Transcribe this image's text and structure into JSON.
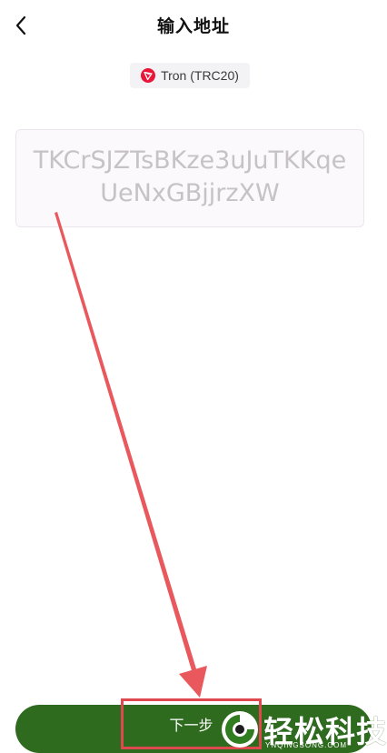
{
  "header": {
    "title": "输入地址",
    "back_icon": "chevron-left-icon"
  },
  "network": {
    "label": "Tron (TRC20)",
    "icon": "tron-icon",
    "icon_color": "#e8173a"
  },
  "address": {
    "placeholder": "TKCrSJZTsBKze3uJuTKKqeUeNxGBjjrzXW"
  },
  "annotation": {
    "arrow_color": "#e8585d",
    "box_color": "#e0484f"
  },
  "footer": {
    "next_label": "下一步",
    "button_color": "#2f6b1f"
  },
  "watermark": {
    "brand": "轻松科技",
    "site": "YNQINGSONG.COM"
  }
}
